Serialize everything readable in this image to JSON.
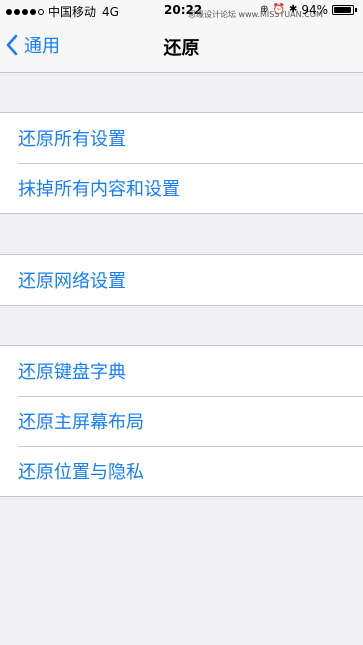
{
  "status_bar": {
    "carrier": "中国移动",
    "network": "4G",
    "time": "20:22",
    "battery": "94%",
    "battery_level": 0.94,
    "watermark": "思缘设计论坛 www.MISSYUAN.COM"
  },
  "nav": {
    "back_label": "通用",
    "title": "还原"
  },
  "groups": [
    {
      "items": [
        "还原所有设置",
        "抹掉所有内容和设置"
      ]
    },
    {
      "items": [
        "还原网络设置"
      ]
    },
    {
      "items": [
        "还原键盘字典",
        "还原主屏幕布局",
        "还原位置与隐私"
      ]
    }
  ],
  "colors": {
    "accent": "#157efb",
    "background": "#efeff4",
    "separator": "#c8c7cc"
  }
}
